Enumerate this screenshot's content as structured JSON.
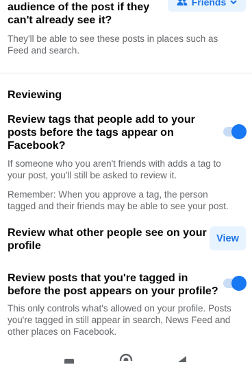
{
  "audience": {
    "title_line1": "audience of the post if they",
    "title_line2": "can't already see it?",
    "description_line1": "They'll be able to see these posts in places such as",
    "description_line2": "Feed and search.",
    "button_label": "Friends"
  },
  "reviewing": {
    "heading": "Reviewing",
    "review_tags": {
      "title_line1": "Review tags that people add to your",
      "title_line2": "posts before the tags appear on",
      "title_line3": "Facebook?",
      "desc1_line1": "If someone who you aren't friends with adds a tag to",
      "desc1_line2": "your post, you'll still be asked to review it.",
      "desc2_line1": "Remember: When you approve a tag, the person",
      "desc2_line2": "tagged and their friends may be able to see your post.",
      "enabled": true
    },
    "review_profile": {
      "title_line1": "Review what other people see on your",
      "title_line2": "profile",
      "button_label": "View"
    },
    "review_posts": {
      "title_line1": "Review posts that you're tagged in",
      "title_line2": "before the post appears on your profile?",
      "desc_line1": "This only controls what's allowed on your profile. Posts",
      "desc_line2": "you're tagged in still appear in search, News Feed and",
      "desc_line3": "other places on Facebook.",
      "enabled": true
    }
  },
  "navbar": {
    "icons": [
      "recent-apps-icon",
      "home-icon",
      "back-icon"
    ]
  },
  "colors": {
    "accent": "#1877f2",
    "button_bg": "#e7f3ff",
    "secondary_text": "#65676b"
  }
}
